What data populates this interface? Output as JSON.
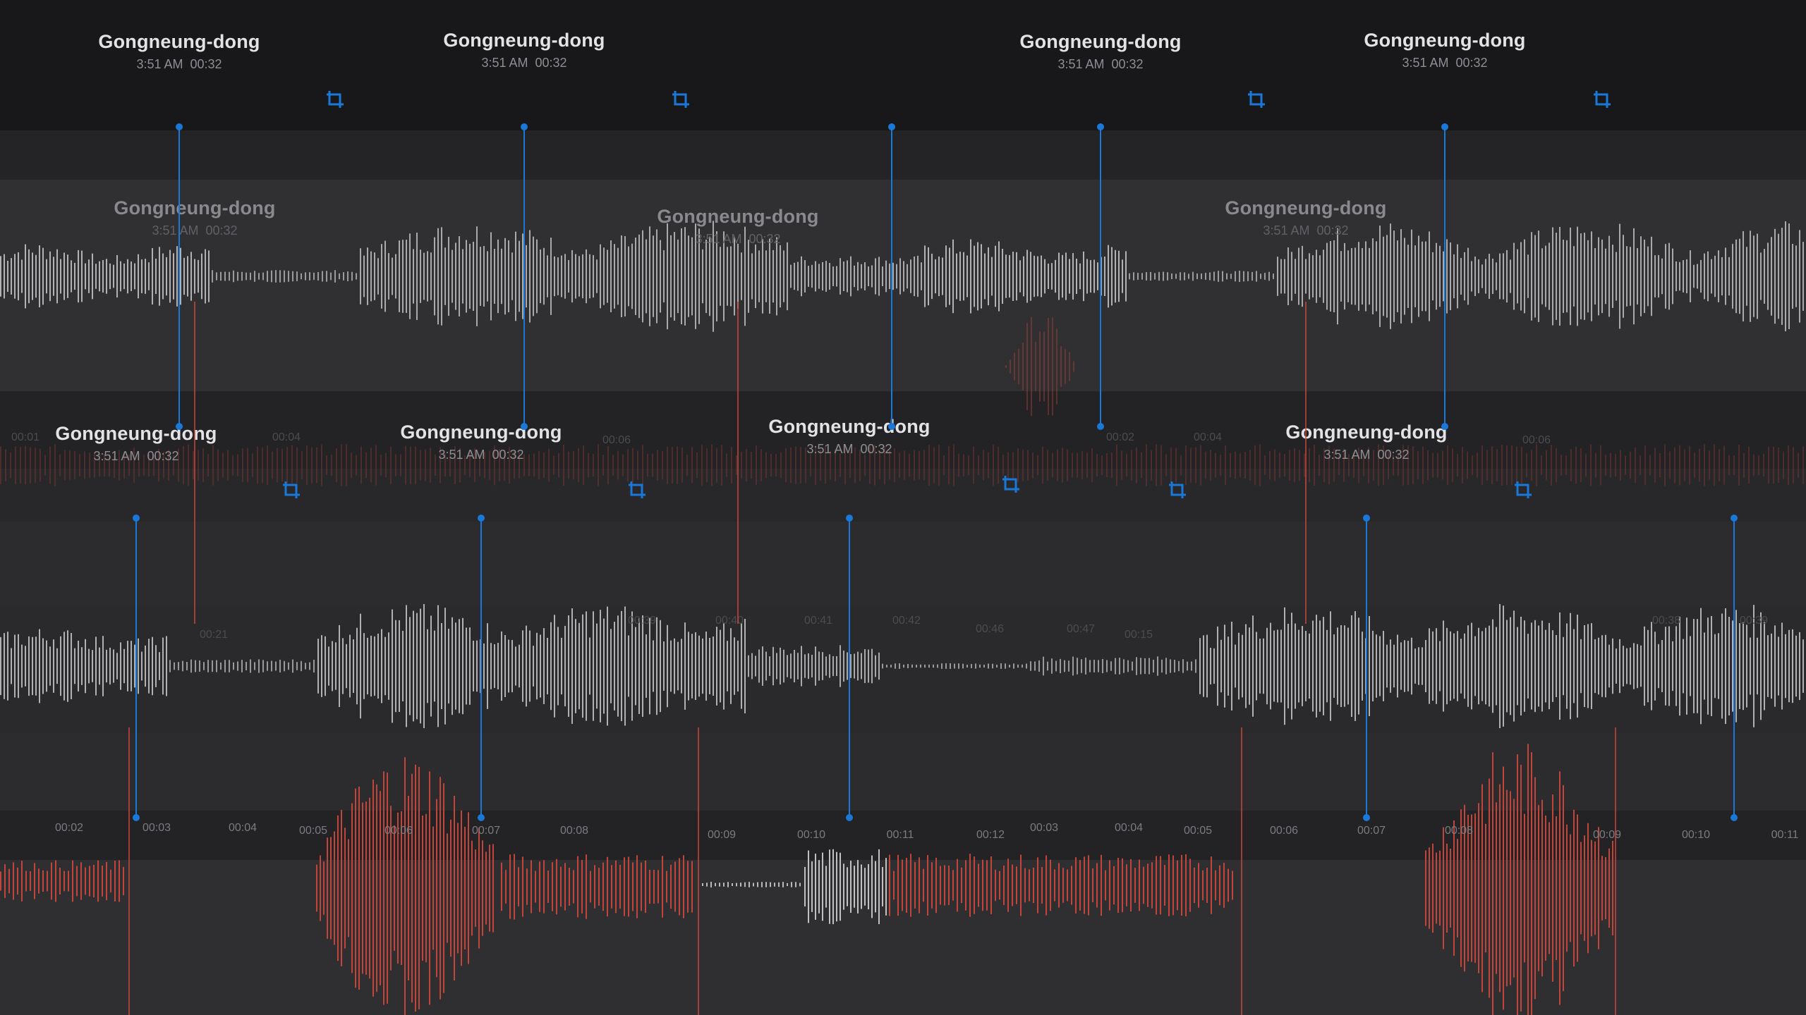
{
  "recording": {
    "title": "Gongneung-dong",
    "time": "3:51 AM",
    "duration": "00:32"
  },
  "colors": {
    "playhead": "#1a78d8",
    "waveform": "#c9c9cc",
    "waveform_dim": "#8d8d91",
    "recorded": "#c9473c",
    "crop_icon": "#1a78d8"
  },
  "icons": [
    "crop-icon"
  ],
  "ruler_lower": [
    "00:02",
    "00:03",
    "00:04",
    "00:05",
    "00:06",
    "00:07",
    "00:08",
    "00:09",
    "00:10",
    "00:11",
    "00:12",
    "00:03",
    "00:04",
    "00:05",
    "00:06",
    "00:07",
    "00:08",
    "00:09",
    "00:10",
    "00:11"
  ],
  "ruler_mid": [
    "00:21",
    "00:39",
    "00:40",
    "00:41",
    "00:42",
    "00:46",
    "00:47",
    "00:15",
    "00:38",
    "00:39"
  ],
  "ruler_upper": [
    "00:01",
    "00:04",
    "00:06",
    "00:02",
    "00:04",
    "00:06"
  ]
}
